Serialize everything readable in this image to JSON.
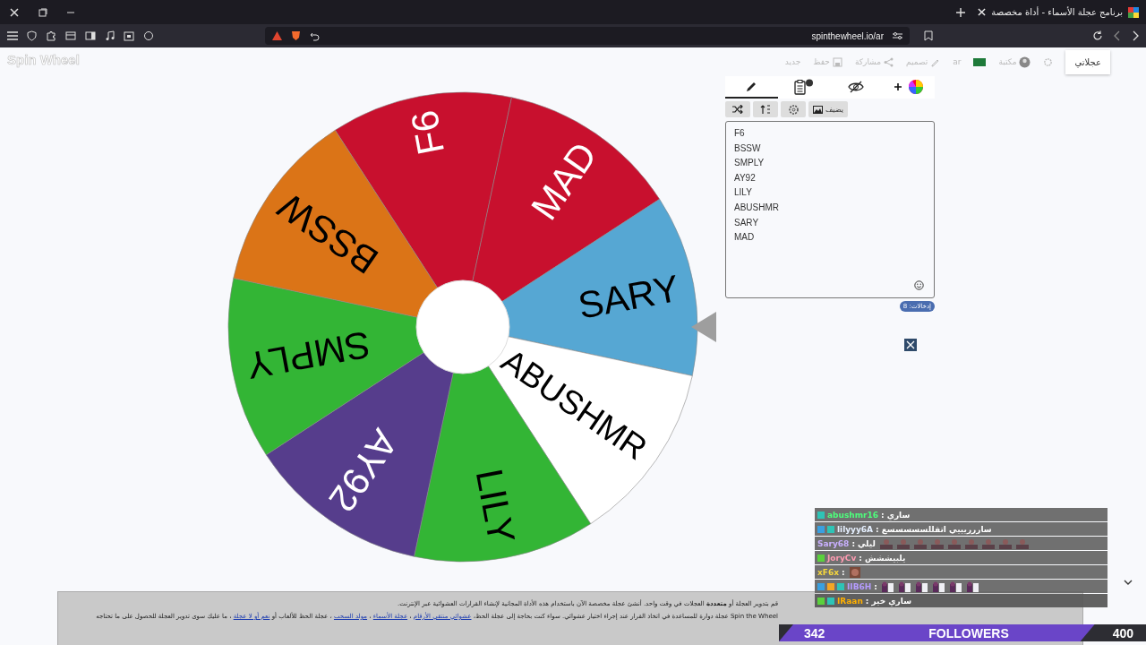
{
  "browser": {
    "tab_title": "برنامج عجلة الأسماء - أداة مخصصة",
    "url": "spinthewheel.io/ar"
  },
  "site": {
    "logo": "Spin Wheel",
    "toolbar": [
      {
        "kind": "button",
        "label": "عجلاتي"
      },
      {
        "kind": "settings"
      },
      {
        "kind": "avatar",
        "label": "مكتبة"
      },
      {
        "kind": "flag"
      },
      {
        "kind": "text",
        "label": "ar"
      },
      {
        "kind": "pencil",
        "label": "تصميم"
      },
      {
        "kind": "share",
        "label": "مشاركة"
      },
      {
        "kind": "save",
        "label": "حفظ"
      },
      {
        "kind": "text",
        "label": "جديد"
      }
    ]
  },
  "wheel": {
    "segments": [
      {
        "label": "F6",
        "color": "#c8102e"
      },
      {
        "label": "MAD",
        "color": "#c8102e"
      },
      {
        "label": "SARY",
        "color": "#56a7d3"
      },
      {
        "label": "ABUSHMR",
        "color": "#ffffff"
      },
      {
        "label": "LILY",
        "color": "#33b535"
      },
      {
        "label": "AY92",
        "color": "#563d8c"
      },
      {
        "label": "SMPLY",
        "color": "#33b535"
      },
      {
        "label": "BSSW",
        "color": "#db7417"
      }
    ]
  },
  "editor": {
    "tabs": [
      {
        "kind": "pencil",
        "selected": true
      },
      {
        "kind": "clipboard",
        "selected": false
      },
      {
        "kind": "hidden",
        "selected": false
      },
      {
        "kind": "colors",
        "selected": false
      }
    ],
    "buttons": [
      {
        "kind": "shuffle"
      },
      {
        "kind": "sort"
      },
      {
        "kind": "gear"
      },
      {
        "kind": "image",
        "label": "يضيف"
      }
    ],
    "entries": [
      "F6",
      "BSSW",
      "SMPLY",
      "AY92",
      "LILY",
      "ABUSHMR",
      "SARY",
      "MAD"
    ],
    "count": "إدخالات: 8"
  },
  "chat": [
    {
      "badges": [
        {
          "color": "#2ec4b6"
        }
      ],
      "user": "abushmr16",
      "color": "#4dff7c",
      "separator": ":",
      "message": "ساري"
    },
    {
      "badges": [
        {
          "color": "#3aa0e0"
        },
        {
          "color": "#2ec4b6"
        }
      ],
      "user": "lilyyy6A",
      "color": "#e6f0ff",
      "separator": ":",
      "message": "ساررريييي اتقللسسسسسع"
    },
    {
      "user": "Sary68",
      "color": "#c9b0ff",
      "separator": ":",
      "message": "ليلي",
      "emotes": [
        {
          "kind": "figure"
        },
        {
          "kind": "figure"
        },
        {
          "kind": "figure"
        },
        {
          "kind": "figure"
        },
        {
          "kind": "figure"
        },
        {
          "kind": "figure"
        },
        {
          "kind": "figure"
        },
        {
          "kind": "figure"
        },
        {
          "kind": "figure"
        }
      ]
    },
    {
      "badges": [
        {
          "color": "#5bd13d"
        }
      ],
      "user": "JoryCv",
      "color": "#ff9bb2",
      "separator": ":",
      "message": "يلبيششش"
    },
    {
      "user": "xF6x",
      "color": "#f5d63d",
      "separator": ":",
      "emotes": [
        {
          "kind": "face"
        }
      ]
    },
    {
      "badges": [
        {
          "color": "#3aa0e0"
        },
        {
          "color": "#f5a623"
        },
        {
          "color": "#2ec4b6"
        }
      ],
      "user": "IIB6H",
      "color": "#b59cff",
      "separator": ":",
      "emotes": [
        {
          "kind": "pair"
        },
        {
          "kind": "pair"
        },
        {
          "kind": "pair"
        },
        {
          "kind": "pair"
        },
        {
          "kind": "pair"
        },
        {
          "kind": "pair"
        }
      ]
    },
    {
      "badges": [
        {
          "color": "#5bd13d"
        },
        {
          "color": "#2ec4b6"
        }
      ],
      "user": "IRaan",
      "color": "#ffb000",
      "separator": ":",
      "message": "ساري خير"
    }
  ],
  "followers": {
    "current": "342",
    "label": "FOLLOWERS",
    "goal": "400",
    "level": 0.86
  },
  "footer": {
    "intro": "قم بتدوير العجلة أو **متعددة** العجلات في وقت واحد. أنشئ عجلة مخصصة الآن باستخدام هذه الأداة المجانية لإنشاء القرارات العشوائية عبر الإنترنت.",
    "parts": [
      {
        "kind": "text",
        "text": "Spin the Wheel عجلة دوارة للمساعدة في اتخاذ القرار عند إجراء اختيار عشوائي. سواء كنت بحاجة إلى عجلة الحظ،"
      },
      {
        "kind": "link",
        "text": "عشوائي منتقي الأرقام"
      },
      {
        "kind": "text",
        "text": "،"
      },
      {
        "kind": "link",
        "text": "عجلة الأسماء"
      },
      {
        "kind": "text",
        "text": "،"
      },
      {
        "kind": "link",
        "text": "مولد السحب"
      },
      {
        "kind": "text",
        "text": "، عجلة الحظ للألعاب أو"
      },
      {
        "kind": "link",
        "text": "نعم أو لا عجلة"
      },
      {
        "kind": "text",
        "text": "، ما عليك سوى تدوير العجلة للحصول على ما تحتاجه"
      }
    ]
  }
}
